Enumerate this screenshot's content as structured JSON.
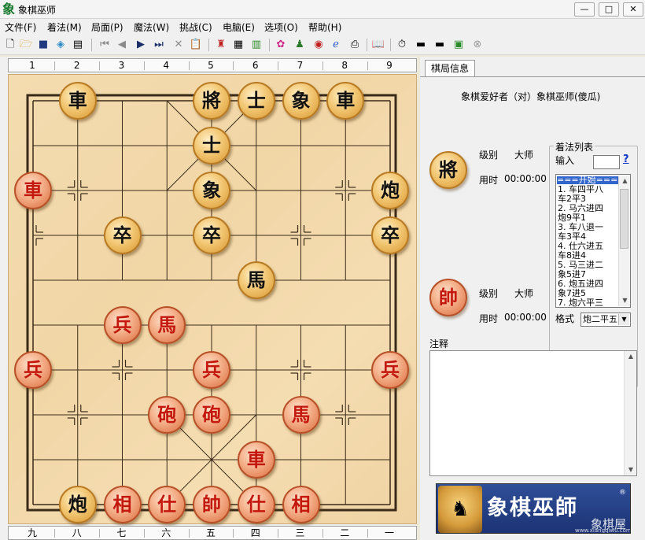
{
  "window": {
    "title": "象棋巫师",
    "app_icon": "象"
  },
  "menu": [
    "文件(F)",
    "着法(M)",
    "局面(P)",
    "魔法(W)",
    "挑战(C)",
    "电脑(E)",
    "选项(O)",
    "帮助(H)"
  ],
  "board": {
    "top_labels": [
      "1",
      "2",
      "3",
      "4",
      "5",
      "6",
      "7",
      "8",
      "9"
    ],
    "bottom_labels": [
      "九",
      "八",
      "七",
      "六",
      "五",
      "四",
      "三",
      "二",
      "一"
    ],
    "pieces": [
      {
        "char": "車",
        "side": "black",
        "col": 1,
        "row": 0
      },
      {
        "char": "將",
        "side": "black",
        "col": 4,
        "row": 0
      },
      {
        "char": "士",
        "side": "black",
        "col": 5,
        "row": 0
      },
      {
        "char": "象",
        "side": "black",
        "col": 6,
        "row": 0
      },
      {
        "char": "車",
        "side": "black",
        "col": 7,
        "row": 0
      },
      {
        "char": "士",
        "side": "black",
        "col": 4,
        "row": 1
      },
      {
        "char": "車",
        "side": "red",
        "col": 0,
        "row": 2
      },
      {
        "char": "象",
        "side": "black",
        "col": 4,
        "row": 2
      },
      {
        "char": "炮",
        "side": "black",
        "col": 8,
        "row": 2
      },
      {
        "char": "卒",
        "side": "black",
        "col": 2,
        "row": 3
      },
      {
        "char": "卒",
        "side": "black",
        "col": 4,
        "row": 3
      },
      {
        "char": "卒",
        "side": "black",
        "col": 8,
        "row": 3
      },
      {
        "char": "馬",
        "side": "black",
        "col": 5,
        "row": 4
      },
      {
        "char": "兵",
        "side": "red",
        "col": 2,
        "row": 5
      },
      {
        "char": "馬",
        "side": "red",
        "col": 3,
        "row": 5
      },
      {
        "char": "兵",
        "side": "red",
        "col": 0,
        "row": 6
      },
      {
        "char": "兵",
        "side": "red",
        "col": 4,
        "row": 6
      },
      {
        "char": "兵",
        "side": "red",
        "col": 8,
        "row": 6
      },
      {
        "char": "砲",
        "side": "red",
        "col": 3,
        "row": 7
      },
      {
        "char": "砲",
        "side": "red",
        "col": 4,
        "row": 7
      },
      {
        "char": "馬",
        "side": "red",
        "col": 6,
        "row": 7
      },
      {
        "char": "車",
        "side": "red",
        "col": 5,
        "row": 8
      },
      {
        "char": "炮",
        "side": "black",
        "col": 1,
        "row": 9
      },
      {
        "char": "相",
        "side": "red",
        "col": 2,
        "row": 9
      },
      {
        "char": "仕",
        "side": "red",
        "col": 3,
        "row": 9
      },
      {
        "char": "帥",
        "side": "red",
        "col": 4,
        "row": 9
      },
      {
        "char": "仕",
        "side": "red",
        "col": 5,
        "row": 9
      },
      {
        "char": "相",
        "side": "red",
        "col": 6,
        "row": 9
      }
    ]
  },
  "panel": {
    "tab_label": "棋局信息",
    "players_line": "象棋爱好者（对）象棋巫师(傻瓜)",
    "black_player": {
      "piece": "將",
      "level_label": "级别",
      "level": "大师",
      "time_label": "用时",
      "time": "00:00:00"
    },
    "red_player": {
      "piece": "帥",
      "level_label": "级别",
      "level": "大师",
      "time_label": "用时",
      "time": "00:00:00"
    },
    "moves_title": "着法列表",
    "input_label": "输入",
    "help_icon": "?",
    "moves": [
      "===开始===",
      "1. 车四平八",
      "   车2平3",
      "2. 马六进四",
      "   炮9平1",
      "3. 车八退一",
      "   车3平4",
      "4. 仕六进五",
      "   车8进4",
      "5. 马三进二",
      "   象5进7",
      "6. 炮五进四",
      "   象7进5",
      "7. 炮六平三"
    ],
    "format_label": "格式",
    "format_value": "炮二平五",
    "notes_label": "注释"
  },
  "banner": {
    "title": "象棋巫師",
    "reg": "®",
    "watermark": "象棋屋",
    "url": "www.xiangqiwu.com"
  },
  "colors": {
    "red_piece_text": "#c4170e",
    "black_piece_text": "#111111",
    "board_line": "#3a2a18",
    "banner_bg": "#2f4f98"
  }
}
